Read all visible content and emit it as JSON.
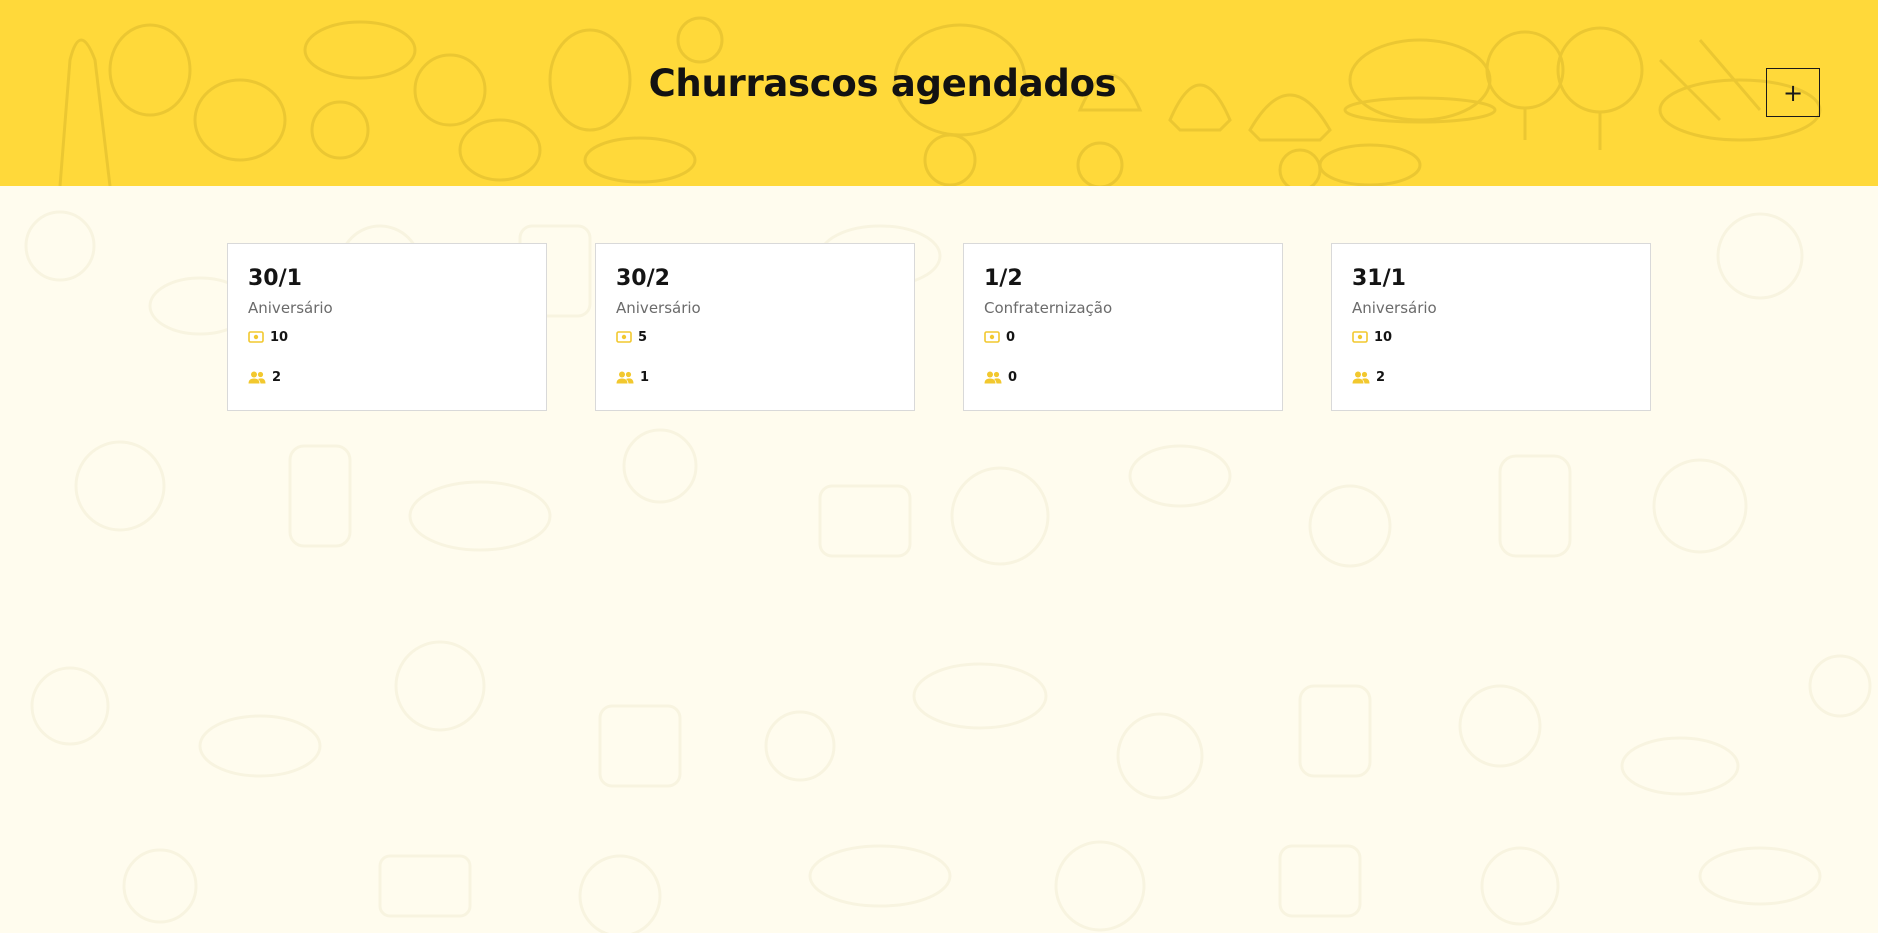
{
  "header": {
    "title": "Churrascos agendados",
    "add_label": "+"
  },
  "colors": {
    "header_bg": "#ffd93a",
    "page_bg": "#fffcee",
    "icon_accent": "#f2c82e"
  },
  "icons": {
    "money": "money-icon",
    "people": "people-icon",
    "add": "plus-icon"
  },
  "events": [
    {
      "date": "30/1",
      "type": "Aniversário",
      "amount": "10",
      "guests": "2"
    },
    {
      "date": "30/2",
      "type": "Aniversário",
      "amount": "5",
      "guests": "1"
    },
    {
      "date": "1/2",
      "type": "Confraternização",
      "amount": "0",
      "guests": "0"
    },
    {
      "date": "31/1",
      "type": "Aniversário",
      "amount": "10",
      "guests": "2"
    }
  ]
}
